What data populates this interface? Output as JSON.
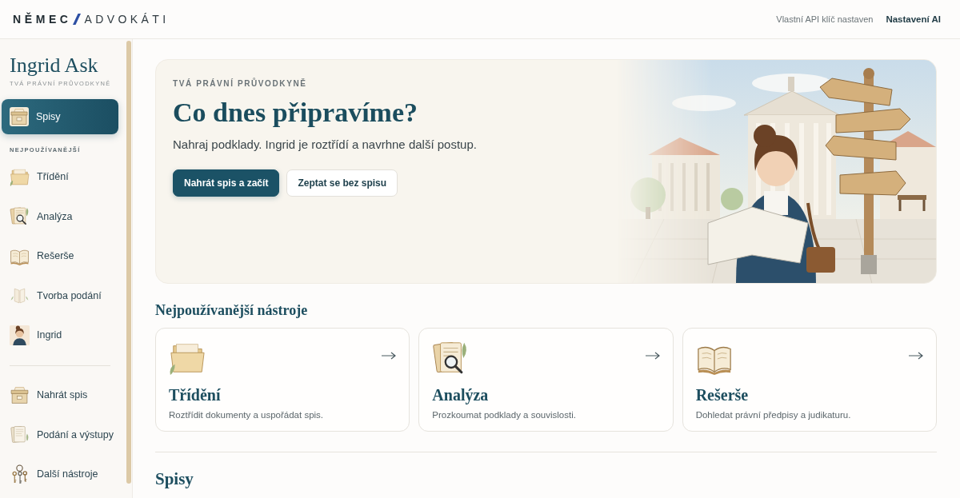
{
  "header": {
    "logo": {
      "primary": "NĚMEC",
      "secondary": "ADVOKÁTI"
    },
    "api_status": "Vlastní API klíč nastaven",
    "settings_link": "Nastavení AI"
  },
  "sidebar": {
    "title": "Ingrid Ask",
    "subtitle": "TVÁ PRÁVNÍ PRŮVODKYNĚ",
    "primary": [
      {
        "label": "Spisy",
        "selected": true
      }
    ],
    "section": {
      "heading": "NEJPOUŽÍVANĚJŠÍ",
      "items": [
        {
          "label": "Třídění",
          "selected": false
        },
        {
          "label": "Analýza",
          "selected": false
        },
        {
          "label": "Rešerše",
          "selected": false
        },
        {
          "label": "Tvorba podání",
          "selected": false
        },
        {
          "label": "Ingrid",
          "selected": false
        }
      ]
    },
    "secondary": [
      {
        "label": "Nahrát spis",
        "selected": false
      },
      {
        "label": "Podání a výstupy",
        "selected": false
      },
      {
        "label": "Další nástroje",
        "selected": false
      }
    ]
  },
  "hero": {
    "eyebrow": "TVÁ PRÁVNÍ PRŮVODKYNĚ",
    "title": "Co dnes připravíme?",
    "text": "Nahraj podklady. Ingrid je roztřídí a navrhne další postup.",
    "buttons": [
      {
        "label": "Nahrát spis a začít",
        "kind": "primary"
      },
      {
        "label": "Zeptat se bez spisu",
        "kind": "secondary"
      }
    ]
  },
  "tools": {
    "heading": "Nejpoužívanější nástroje",
    "cards": [
      {
        "title": "Třídění",
        "description": "Roztřídit dokumenty a uspořádat spis."
      },
      {
        "title": "Analýza",
        "description": "Prozkoumat podklady a souvislosti."
      },
      {
        "title": "Rešerše",
        "description": "Dohledat právní předpisy a judikaturu."
      }
    ]
  },
  "files": {
    "heading": "Spisy"
  }
}
